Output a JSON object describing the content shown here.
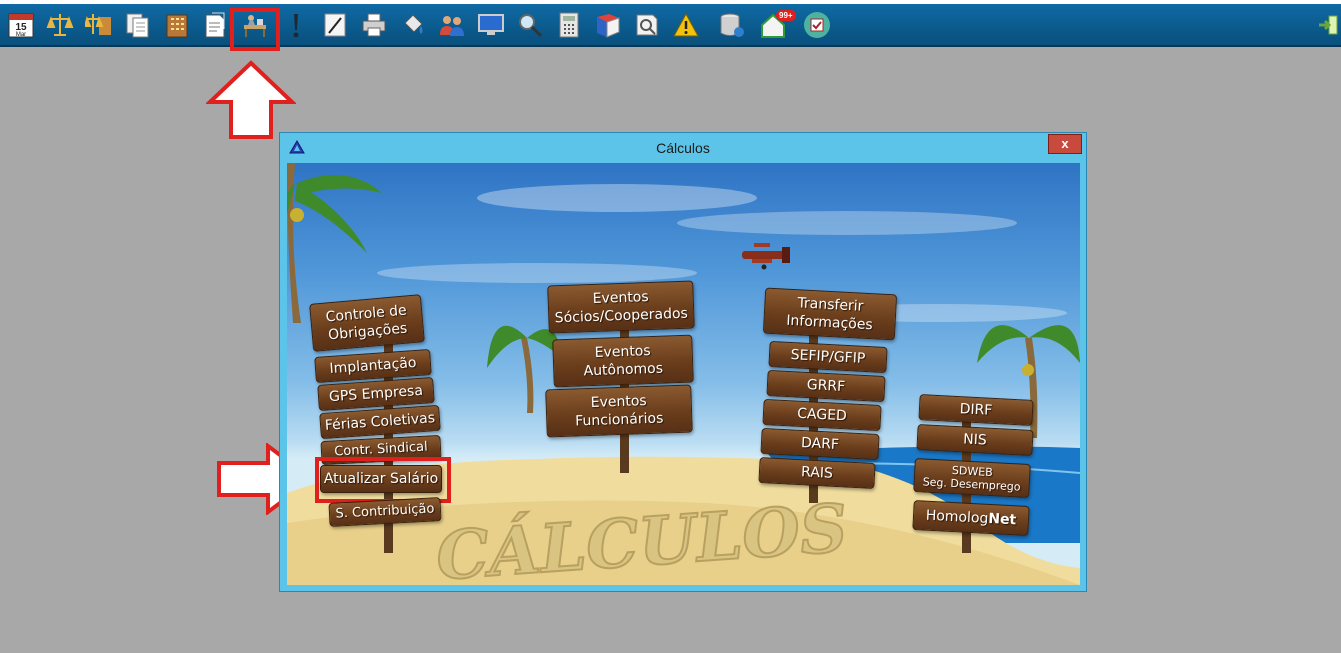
{
  "toolbar": {
    "calendar_day": "15",
    "calendar_month": "Mar",
    "notification_badge": "99+",
    "icons": [
      "calendar-icon",
      "scales-icon",
      "scales-building-icon",
      "documents-icon",
      "building-icon",
      "papers-icon",
      "calculations-desk-icon",
      "exclamation-icon",
      "pen-icon",
      "printer-icon",
      "paint-bucket-icon",
      "users-icon",
      "monitor-icon",
      "magnifier-icon",
      "calculator-icon",
      "book-icon",
      "search-document-icon",
      "warning-icon",
      "database-icon",
      "house-notification-icon",
      "checkbox-icon",
      "exit-icon"
    ]
  },
  "dialog": {
    "title": "Cálculos",
    "close_label": "x"
  },
  "scene": {
    "sand_text": "CÁLCULOS",
    "left_post": [
      "Controle de\nObrigações",
      "Implantação",
      "GPS Empresa",
      "Férias Coletivas",
      "Contr. Sindical",
      "Atualizar Salário",
      "S. Contribuição"
    ],
    "center_post": [
      "Eventos\nSócios/Cooperados",
      "Eventos\nAutônomos",
      "Eventos\nFuncionários"
    ],
    "right_center_post": [
      "Transferir\nInformações",
      "SEFIP/GFIP",
      "GRRF",
      "CAGED",
      "DARF",
      "RAIS"
    ],
    "right_post": [
      "DIRF",
      "NIS",
      "SDWEB\nSeg. Desemprego"
    ],
    "homolognet_prefix": "Homolog",
    "homolognet_suffix": "Net"
  },
  "colors": {
    "toolbar": "#0b5a8c",
    "highlight": "#e0201c",
    "dialog_frame": "#5cc4e8",
    "sign_wood": "#6b3e1c"
  }
}
